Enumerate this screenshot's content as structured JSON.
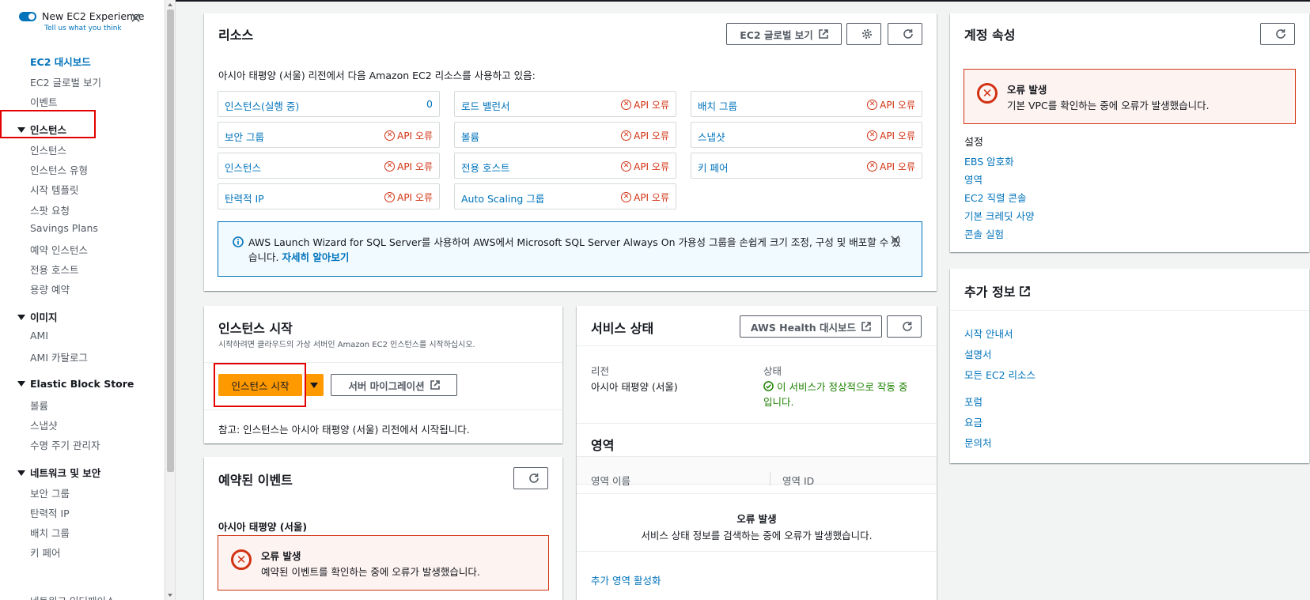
{
  "sidebar": {
    "new_experience_title": "New EC2 Experience",
    "new_experience_link": "Tell us what you think",
    "top_items": [
      "EC2 대시보드",
      "EC2 글로벌 보기",
      "이벤트"
    ],
    "sections": [
      {
        "title": "인스턴스",
        "items": [
          "인스턴스",
          "인스턴스 유형",
          "시작 템플릿",
          "스팟 요청",
          "Savings Plans",
          "예약 인스턴스",
          "전용 호스트",
          "용량 예약"
        ]
      },
      {
        "title": "이미지",
        "items": [
          "AMI",
          "AMI 카탈로그"
        ]
      },
      {
        "title": "Elastic Block Store",
        "items": [
          "볼륨",
          "스냅샷",
          "수명 주기 관리자"
        ]
      },
      {
        "title": "네트워크 및 보안",
        "items": [
          "보안 그룹",
          "탄력적 IP",
          "배치 그룹",
          "키 페어",
          "네트워크 인터페이스"
        ]
      }
    ]
  },
  "resources": {
    "title": "리소스",
    "global_view_button": "EC2 글로벌 보기",
    "description": "아시아 태평양 (서울) 리전에서 다음 Amazon EC2 리소스를 사용하고 있음:",
    "cells": [
      {
        "name": "인스턴스(실행 중)",
        "value": "0"
      },
      {
        "name": "로드 밸런서",
        "value": "API 오류"
      },
      {
        "name": "배치 그룹",
        "value": "API 오류"
      },
      {
        "name": "보안 그룹",
        "value": "API 오류"
      },
      {
        "name": "볼륨",
        "value": "API 오류"
      },
      {
        "name": "스냅샷",
        "value": "API 오류"
      },
      {
        "name": "인스턴스",
        "value": "API 오류"
      },
      {
        "name": "전용 호스트",
        "value": "API 오류"
      },
      {
        "name": "키 페어",
        "value": "API 오류"
      },
      {
        "name": "탄력적 IP",
        "value": "API 오류"
      },
      {
        "name": "Auto Scaling 그룹",
        "value": "API 오류"
      }
    ],
    "info_text_line1": "AWS Launch Wizard for SQL Server를 사용하여 AWS에서 Microsoft SQL Server Always On 가용성 그룹을 손쉽게 크기 조정, 구성 및 배포할 수 있",
    "info_text_line2": "습니다.",
    "info_link": "자세히 알아보기"
  },
  "launch": {
    "title": "인스턴스 시작",
    "subtitle": "시작하려면 클라우드의 가상 서버인 Amazon EC2 인스턴스를 시작하십시오.",
    "launch_button": "인스턴스 시작",
    "migration_button": "서버 마이그레이션",
    "note": "참고: 인스턴스는 아시아 태평양 (서울) 리전에서 시작됩니다."
  },
  "scheduled_events": {
    "title": "예약된 이벤트",
    "region": "아시아 태평양 (서울)",
    "error_title": "오류 발생",
    "error_text": "예약된 이벤트를 확인하는 중에 오류가 발생했습니다."
  },
  "service_health": {
    "title": "서비스 상태",
    "health_button": "AWS Health 대시보드",
    "region_label": "리전",
    "region_value": "아시아 태평양 (서울)",
    "status_label": "상태",
    "status_line1": "이 서비스가 정상적으로 작동 중",
    "status_line2": "입니다.",
    "zones_title": "영역",
    "zone_name_header": "영역 이름",
    "zone_id_header": "영역 ID",
    "zones_error_title": "오류 발생",
    "zones_error_text": "서비스 상태 정보를 검색하는 중에 오류가 발생했습니다.",
    "enable_zones_link": "추가 영역 활성화"
  },
  "account": {
    "title": "계정 속성",
    "error_title": "오류 발생",
    "error_text": "기본 VPC를 확인하는 중에 오류가 발생했습니다.",
    "settings_title": "설정",
    "settings_links": [
      "EBS 암호화",
      "영역",
      "EC2 직렬 콘솔",
      "기본 크레딧 사양",
      "콘솔 실험"
    ]
  },
  "additional": {
    "title": "추가 정보",
    "links": [
      "시작 안내서",
      "설명서",
      "모든 EC2 리소스",
      "포럼",
      "요금",
      "문의처"
    ]
  },
  "colors": {
    "link": "#0073bb",
    "error": "#d13212",
    "success": "#1d8102",
    "primary_button": "#ff9900",
    "highlight": "#e30000"
  }
}
